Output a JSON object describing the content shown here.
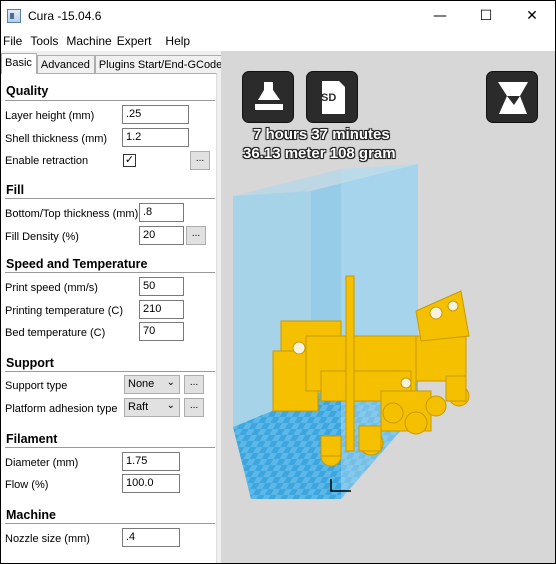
{
  "window": {
    "title": "Cura -15.04.6",
    "minimize_glyph": "—",
    "maximize_glyph": "☐",
    "close_glyph": "✕"
  },
  "menu": [
    "File",
    "Tools",
    "Machine",
    "Expert",
    "Help"
  ],
  "tabs": [
    "Basic",
    "Advanced",
    "Plugins",
    "Start/End-GCode"
  ],
  "sections": {
    "quality": "Quality",
    "fill": "Fill",
    "speed": "Speed and Temperature",
    "support": "Support",
    "filament": "Filament",
    "machine": "Machine"
  },
  "quality": {
    "layer_height_label": "Layer height (mm)",
    "layer_height": ".25",
    "shell_thickness_label": "Shell thickness (mm)",
    "shell_thickness": "1.2",
    "retraction_label": "Enable retraction",
    "retraction_checked": "✓"
  },
  "fill": {
    "bottom_top_label": "Bottom/Top thickness (mm)",
    "bottom_top": ".8",
    "density_label": "Fill Density (%)",
    "density": "20"
  },
  "speed": {
    "print_speed_label": "Print speed (mm/s)",
    "print_speed": "50",
    "print_temp_label": "Printing temperature (C)",
    "print_temp": "210",
    "bed_temp_label": "Bed temperature (C)",
    "bed_temp": "70"
  },
  "support": {
    "type_label": "Support type",
    "type_value": "None",
    "adhesion_label": "Platform adhesion type",
    "adhesion_value": "Raft"
  },
  "filament": {
    "diameter_label": "Diameter (mm)",
    "diameter": "1.75",
    "flow_label": "Flow (%)",
    "flow": "100.0"
  },
  "machine": {
    "nozzle_label": "Nozzle size (mm)",
    "nozzle": ".4"
  },
  "buttons": {
    "more": "..."
  },
  "viewport": {
    "sd_label": "SD",
    "print_time": "7 hours 37 minutes",
    "print_material": "36.13 meter 108 gram",
    "volume_color": "#7ec3e6",
    "floor_color": "#3ea6de",
    "model_color": "#f5c000"
  }
}
